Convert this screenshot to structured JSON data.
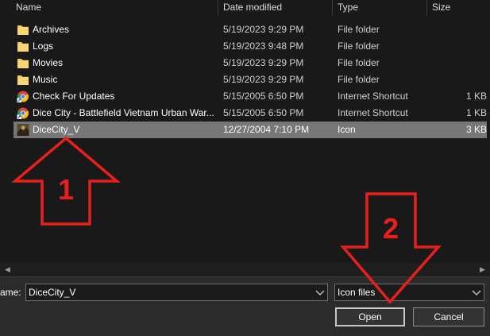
{
  "columns": {
    "name": "Name",
    "date_modified": "Date modified",
    "type": "Type",
    "size": "Size"
  },
  "files": [
    {
      "name": "Archives",
      "date": "5/19/2023 9:29 PM",
      "type": "File folder",
      "size": "",
      "icon": "folder-icon"
    },
    {
      "name": "Logs",
      "date": "5/19/2023 9:48 PM",
      "type": "File folder",
      "size": "",
      "icon": "folder-icon"
    },
    {
      "name": "Movies",
      "date": "5/19/2023 9:29 PM",
      "type": "File folder",
      "size": "",
      "icon": "folder-icon"
    },
    {
      "name": "Music",
      "date": "5/19/2023 9:29 PM",
      "type": "File folder",
      "size": "",
      "icon": "folder-icon"
    },
    {
      "name": "Check For Updates",
      "date": "5/15/2005 6:50 PM",
      "type": "Internet Shortcut",
      "size": "1 KB",
      "icon": "chrome-shortcut-icon"
    },
    {
      "name": "Dice City - Battlefield Vietnam Urban War...",
      "date": "5/15/2005 6:50 PM",
      "type": "Internet Shortcut",
      "size": "1 KB",
      "icon": "chrome-shortcut-icon"
    },
    {
      "name": "DiceCity_V",
      "date": "12/27/2004 7:10 PM",
      "type": "Icon",
      "size": "3 KB",
      "icon": "game-icon-file-icon",
      "selected": true
    }
  ],
  "footer": {
    "file_name_label": "ame:",
    "file_name_value": "DiceCity_V",
    "file_type_value": "Icon files",
    "open_label": "Open",
    "cancel_label": "Cancel"
  },
  "annotations": {
    "arrow_1_label": "1",
    "arrow_2_label": "2",
    "arrow_color": "#e8201c"
  },
  "colors": {
    "background": "#191919",
    "selected_row": "#777777",
    "panel": "#2b2b2b",
    "folder": "#f1c85a"
  }
}
